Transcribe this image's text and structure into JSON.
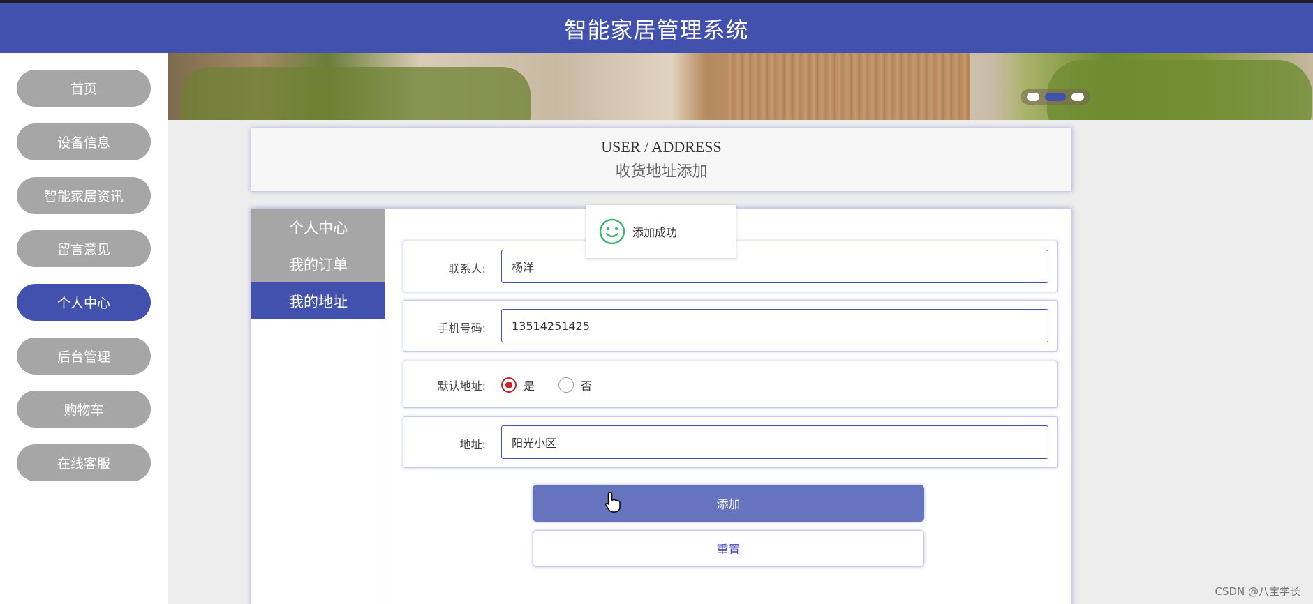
{
  "header": {
    "title": "智能家居管理系统"
  },
  "sidebar": {
    "items": [
      {
        "label": "首页",
        "active": false
      },
      {
        "label": "设备信息",
        "active": false
      },
      {
        "label": "智能家居资讯",
        "active": false
      },
      {
        "label": "留言意见",
        "active": false
      },
      {
        "label": "个人中心",
        "active": true
      },
      {
        "label": "后台管理",
        "active": false
      },
      {
        "label": "购物车",
        "active": false
      },
      {
        "label": "在线客服",
        "active": false
      }
    ]
  },
  "banner": {
    "slide_count": 3,
    "active_slide": 2
  },
  "page_title": {
    "en": "USER / ADDRESS",
    "cn": "收货地址添加"
  },
  "subnav": {
    "items": [
      {
        "label": "个人中心",
        "active": false
      },
      {
        "label": "我的订单",
        "active": false
      },
      {
        "label": "我的地址",
        "active": true
      }
    ]
  },
  "form": {
    "contact": {
      "label": "联系人:",
      "value": "杨洋"
    },
    "phone": {
      "label": "手机号码:",
      "value": "13514251425"
    },
    "default_address": {
      "label": "默认地址:",
      "options": [
        "是",
        "否"
      ],
      "selected": "是"
    },
    "address": {
      "label": "地址:",
      "value": "阳光小区"
    },
    "add_label": "添加",
    "reset_label": "重置"
  },
  "toast": {
    "text": "添加成功"
  },
  "watermark": "CSDN @八宝学长",
  "colors": {
    "primary": "#4250ae",
    "nav_inactive": "#a6a6a6",
    "radio_checked": "#c0262d",
    "success_icon": "#3cb371"
  }
}
